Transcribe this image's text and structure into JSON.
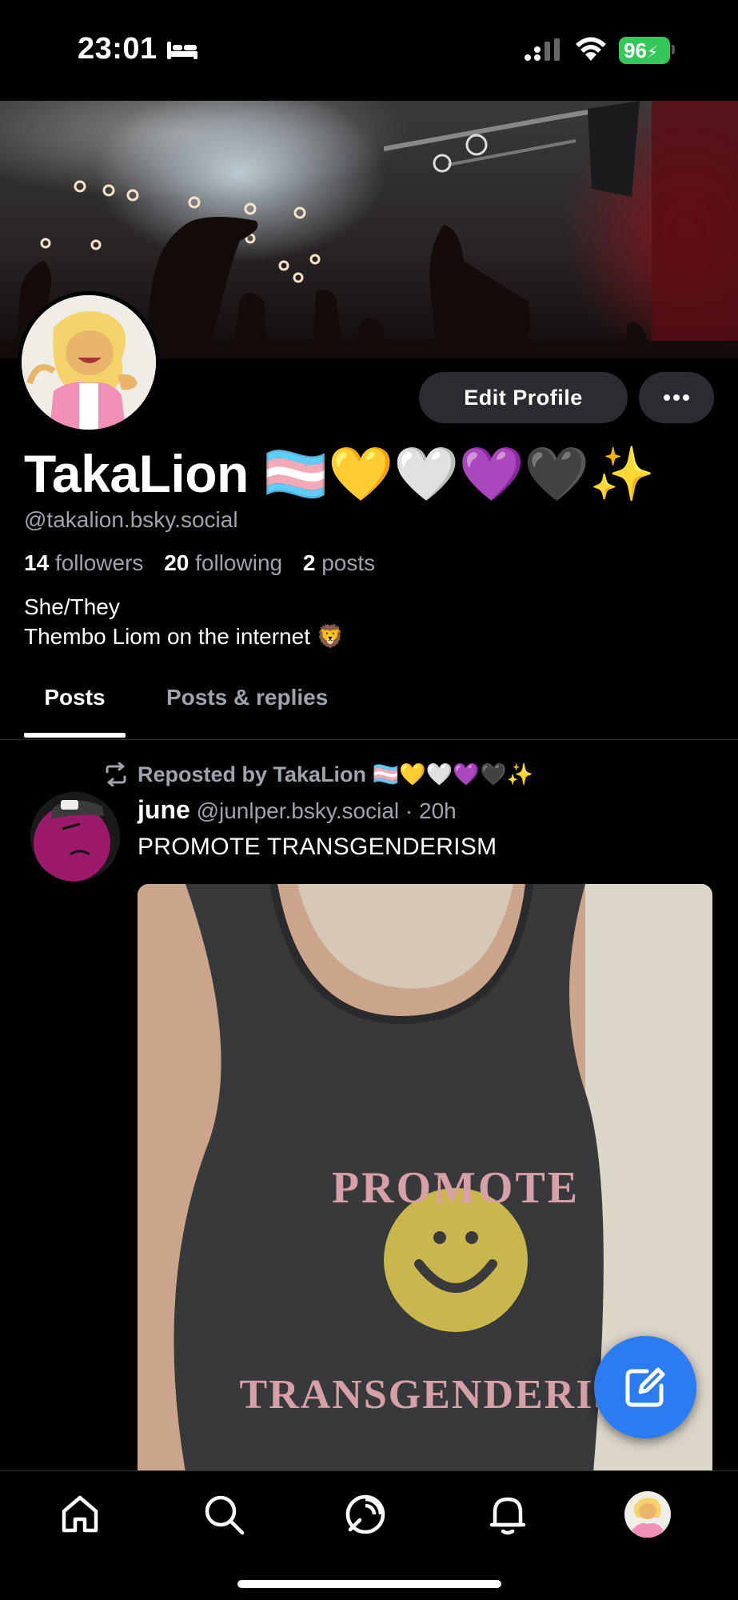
{
  "status_bar": {
    "time": "23:01",
    "battery": "96"
  },
  "profile": {
    "display_name": "TakaLion 🏳️‍⚧️💛🤍💜🖤✨",
    "handle": "@takalion.bsky.social",
    "followers_count": "14",
    "followers_label": "followers",
    "following_count": "20",
    "following_label": "following",
    "posts_count": "2",
    "posts_label": "posts",
    "bio_line1": "She/They",
    "bio_line2": "Thembo Liom on the internet 🦁",
    "edit_button": "Edit Profile"
  },
  "tabs": [
    {
      "label": "Posts",
      "active": true
    },
    {
      "label": "Posts & replies",
      "active": false
    }
  ],
  "post": {
    "repost_label": "Reposted by TakaLion 🏳️‍⚧️💛🤍💜🖤✨",
    "author": "june",
    "handle": "@junlper.bsky.social",
    "time": "· 20h",
    "text": "PROMOTE TRANSGENDERISM",
    "image_text_top": "PROMOTE",
    "image_text_bottom": "TRANSGENDERISM"
  },
  "nav": {
    "items": [
      "home-icon",
      "search-icon",
      "feeds-icon",
      "notifications-icon",
      "profile-avatar"
    ]
  },
  "colors": {
    "accent": "#2b7bf2",
    "muted_text": "#9ea3ad",
    "button_bg": "#2a2c31",
    "battery": "#34c759"
  }
}
